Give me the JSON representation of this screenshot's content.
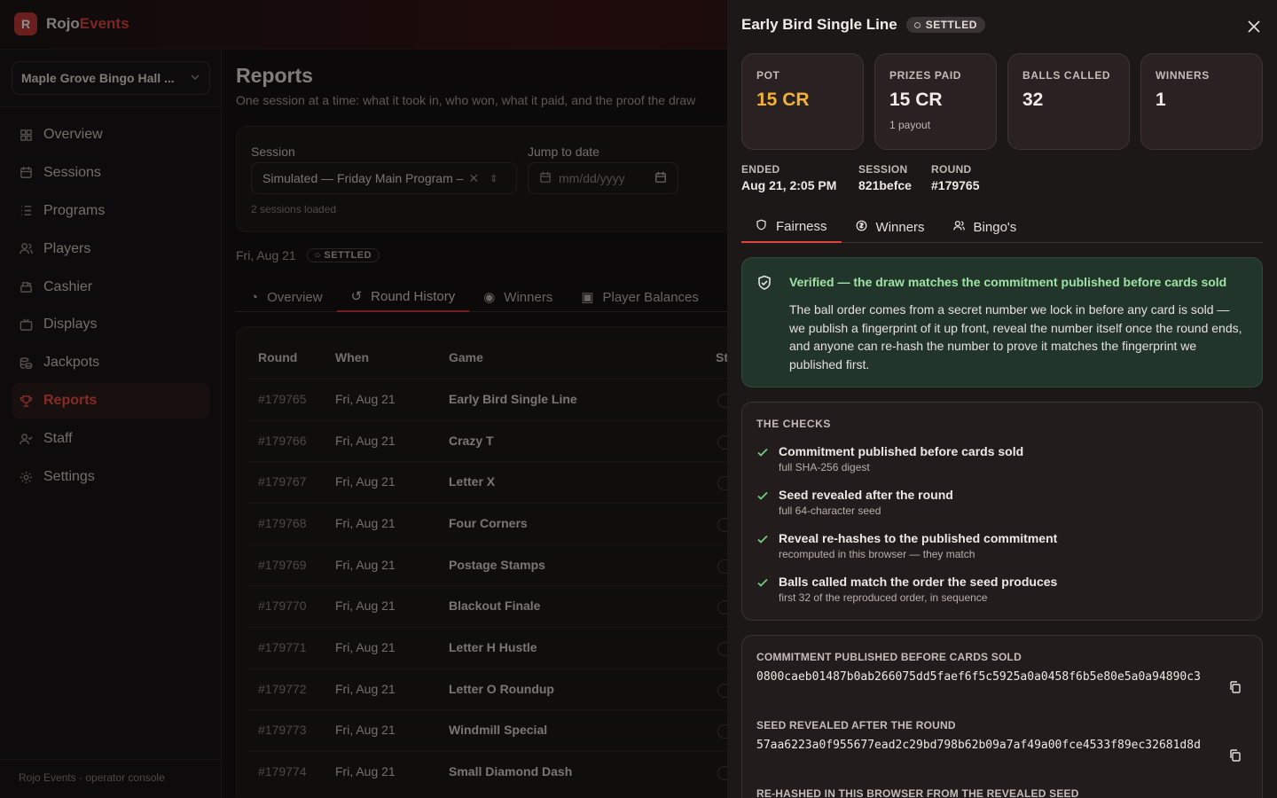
{
  "app": {
    "brand_main": "Rojo",
    "brand_accent": "Events",
    "logo_letter": "R"
  },
  "sidebar": {
    "venue": "Maple Grove Bingo Hall ...",
    "items": [
      {
        "label": "Overview",
        "icon": "grid-icon"
      },
      {
        "label": "Sessions",
        "icon": "calendar-icon"
      },
      {
        "label": "Programs",
        "icon": "list-icon"
      },
      {
        "label": "Players",
        "icon": "users-icon"
      },
      {
        "label": "Cashier",
        "icon": "cash-register-icon"
      },
      {
        "label": "Displays",
        "icon": "tv-icon"
      },
      {
        "label": "Jackpots",
        "icon": "coins-icon"
      },
      {
        "label": "Reports",
        "icon": "trophy-icon"
      },
      {
        "label": "Staff",
        "icon": "staff-icon"
      },
      {
        "label": "Settings",
        "icon": "gear-icon"
      }
    ],
    "active": "Reports",
    "footer": "Rojo Events · operator console"
  },
  "main": {
    "title": "Reports",
    "subtitle": "One session at a time: what it took in, who won, what it paid, and the proof the draw",
    "filters": {
      "session_label": "Session",
      "session_value": "Simulated — Friday Main Program –",
      "date_label": "Jump to date",
      "date_placeholder": "mm/dd/yyyy",
      "note": "2 sessions loaded"
    },
    "session_date": "Fri, Aug 21",
    "session_status": "SETTLED",
    "tabs": [
      "Overview",
      "Round History",
      "Winners",
      "Player Balances"
    ],
    "active_tab": "Round History",
    "table": {
      "headers": [
        "Round",
        "When",
        "Game",
        "St"
      ],
      "rows": [
        {
          "round": "#179765",
          "when": "Fri, Aug 21",
          "game": "Early Bird Single Line"
        },
        {
          "round": "#179766",
          "when": "Fri, Aug 21",
          "game": "Crazy T"
        },
        {
          "round": "#179767",
          "when": "Fri, Aug 21",
          "game": "Letter X"
        },
        {
          "round": "#179768",
          "when": "Fri, Aug 21",
          "game": "Four Corners"
        },
        {
          "round": "#179769",
          "when": "Fri, Aug 21",
          "game": "Postage Stamps"
        },
        {
          "round": "#179770",
          "when": "Fri, Aug 21",
          "game": "Blackout Finale"
        },
        {
          "round": "#179771",
          "when": "Fri, Aug 21",
          "game": "Letter H Hustle"
        },
        {
          "round": "#179772",
          "when": "Fri, Aug 21",
          "game": "Letter O Roundup"
        },
        {
          "round": "#179773",
          "when": "Fri, Aug 21",
          "game": "Windmill Special"
        },
        {
          "round": "#179774",
          "when": "Fri, Aug 21",
          "game": "Small Diamond Dash"
        }
      ]
    }
  },
  "drawer": {
    "title": "Early Bird Single Line",
    "status": "SETTLED",
    "stats": [
      {
        "label": "POT",
        "value": "15 CR",
        "sub": ""
      },
      {
        "label": "PRIZES PAID",
        "value": "15 CR",
        "sub": "1 payout"
      },
      {
        "label": "BALLS CALLED",
        "value": "32",
        "sub": ""
      },
      {
        "label": "WINNERS",
        "value": "1",
        "sub": ""
      }
    ],
    "meta": [
      {
        "label": "ENDED",
        "value": "Aug 21, 2:05 PM"
      },
      {
        "label": "SESSION",
        "value": "821befce"
      },
      {
        "label": "ROUND",
        "value": "#179765"
      }
    ],
    "tabs": [
      "Fairness",
      "Winners",
      "Bingo's"
    ],
    "active_tab": "Fairness",
    "verify": {
      "title": "Verified — the draw matches the commitment published before cards sold",
      "body": "The ball order comes from a secret number we lock in before any card is sold — we publish a fingerprint of it up front, reveal the number itself once the round ends, and anyone can re-hash the number to prove it matches the fingerprint we published first."
    },
    "checks": {
      "title": "THE CHECKS",
      "items": [
        {
          "title": "Commitment published before cards sold",
          "sub": "full SHA-256 digest"
        },
        {
          "title": "Seed revealed after the round",
          "sub": "full 64-character seed"
        },
        {
          "title": "Reveal re-hashes to the published commitment",
          "sub": "recomputed in this browser — they match"
        },
        {
          "title": "Balls called match the order the seed produces",
          "sub": "first 32 of the reproduced order, in sequence"
        }
      ]
    },
    "hashes": [
      {
        "label": "COMMITMENT PUBLISHED BEFORE CARDS SOLD",
        "value": "0800caeb01487b0ab266075dd5faef6f5c5925a0a0458f6b5e80e5a0a94890c3"
      },
      {
        "label": "SEED REVEALED AFTER THE ROUND",
        "value": "57aa6223a0f955677ead2c29bd798b62b09a7af49a00fce4533f89ec32681d8d"
      },
      {
        "label": "RE-HASHED IN THIS BROWSER FROM THE REVEALED SEED",
        "value": ""
      }
    ]
  },
  "colors": {
    "accent": "#e0453e",
    "gold": "#f2b134",
    "verified": "#9ee2a4"
  }
}
